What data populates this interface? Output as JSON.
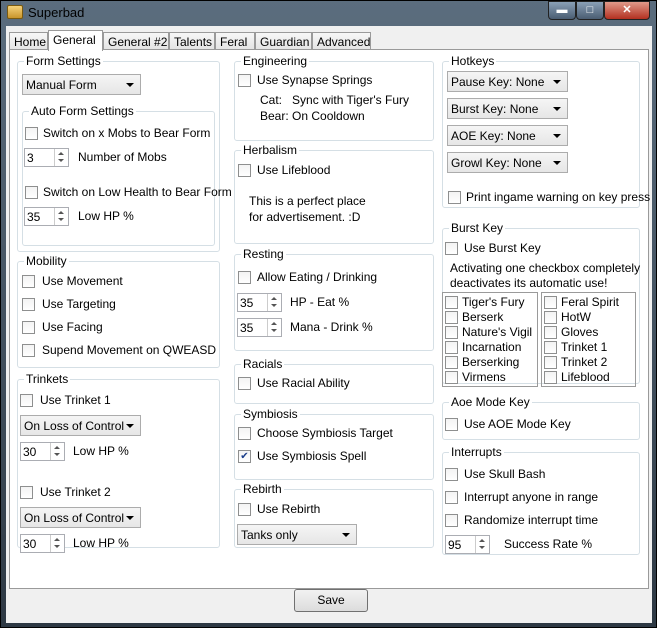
{
  "window": {
    "title": "Superbad",
    "minimize": "▬",
    "maximize": "□",
    "close": "✕"
  },
  "tabs": [
    "Home",
    "General",
    "General #2",
    "Talents",
    "Feral",
    "Guardian",
    "Advanced"
  ],
  "form_settings": {
    "legend": "Form Settings",
    "form_mode": "Manual Form",
    "auto": {
      "legend": "Auto Form Settings",
      "switch_mobs": "Switch on x Mobs to Bear Form",
      "mobs_value": "3",
      "mobs_label": "Number of Mobs",
      "switch_hp": "Switch on Low Health to Bear Form",
      "hp_value": "35",
      "hp_label": "Low HP %"
    }
  },
  "mobility": {
    "legend": "Mobility",
    "use_movement": "Use Movement",
    "use_targeting": "Use Targeting",
    "use_facing": "Use Facing",
    "suspend": "Supend Movement on QWEASD"
  },
  "trinkets": {
    "legend": "Trinkets",
    "t1": "Use Trinket 1",
    "t1_mode": "On Loss of Control",
    "t1_hp": "30",
    "t1_hp_label": "Low HP %",
    "t2": "Use Trinket 2",
    "t2_mode": "On Loss of Control",
    "t2_hp": "30",
    "t2_hp_label": "Low HP %"
  },
  "engineering": {
    "legend": "Engineering",
    "synapse": "Use Synapse Springs",
    "cat": "Cat:   Sync with Tiger's Fury",
    "bear": "Bear: On Cooldown"
  },
  "herbalism": {
    "legend": "Herbalism",
    "lifeblood": "Use Lifeblood",
    "ad1": "This is a perfect place",
    "ad2": "for advertisement. :D"
  },
  "resting": {
    "legend": "Resting",
    "allow": "Allow Eating / Drinking",
    "hp_value": "35",
    "hp_label": "HP - Eat %",
    "mana_value": "35",
    "mana_label": "Mana - Drink %"
  },
  "racials": {
    "legend": "Racials",
    "use": "Use Racial Ability"
  },
  "symbiosis": {
    "legend": "Symbiosis",
    "choose": "Choose Symbiosis Target",
    "use": "Use Symbiosis Spell"
  },
  "rebirth": {
    "legend": "Rebirth",
    "use": "Use Rebirth",
    "mode": "Tanks only"
  },
  "hotkeys": {
    "legend": "Hotkeys",
    "pause": "Pause Key: None",
    "burst": "Burst Key: None",
    "aoe": "AOE Key: None",
    "growl": "Growl Key: None",
    "print": "Print ingame warning on key press"
  },
  "burst_key": {
    "legend": "Burst Key",
    "use": "Use Burst Key",
    "note1": "Activating one checkbox completely",
    "note2": "deactivates its automatic use!",
    "left": [
      "Tiger's Fury",
      "Berserk",
      "Nature's Vigil",
      "Incarnation",
      "Berserking",
      "Virmens"
    ],
    "right": [
      "Feral Spirit",
      "HotW",
      "Gloves",
      "Trinket 1",
      "Trinket 2",
      "Lifeblood"
    ]
  },
  "aoe_mode": {
    "legend": "Aoe Mode Key",
    "use": "Use AOE Mode Key"
  },
  "interrupts": {
    "legend": "Interrupts",
    "skull": "Use Skull Bash",
    "anyone": "Interrupt anyone in range",
    "random": "Randomize interrupt time",
    "rate_value": "95",
    "rate_label": "Success Rate %"
  },
  "save": "Save"
}
